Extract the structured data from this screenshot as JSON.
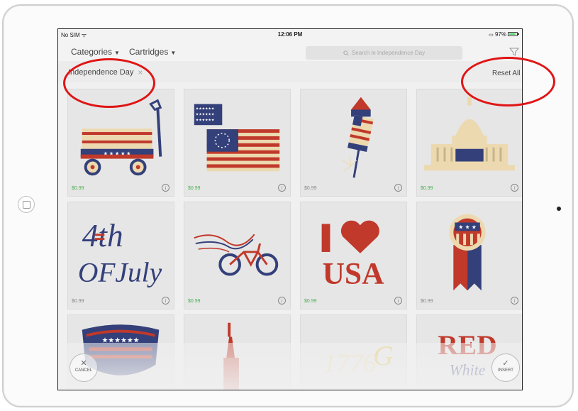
{
  "status_bar": {
    "carrier": "No SIM ᯤ",
    "time": "12:06 PM",
    "battery": "97%"
  },
  "toolbar": {
    "categories_label": "Categories",
    "cartridges_label": "Cartridges",
    "search_placeholder": "Search in Independence Day"
  },
  "filters": {
    "active_chip": "Independence Day",
    "chip_close": "×",
    "reset_label": "Reset All"
  },
  "tiles": [
    {
      "name": "wagon",
      "price": "$0.99"
    },
    {
      "name": "flags",
      "price": "$0.99"
    },
    {
      "name": "firework-rocket",
      "price": "$0.99"
    },
    {
      "name": "capitol",
      "price": "$0.99"
    },
    {
      "name": "4th-of-july",
      "price": "$0.99"
    },
    {
      "name": "bicycle",
      "price": "$0.99"
    },
    {
      "name": "i-love-usa",
      "price": "$0.99"
    },
    {
      "name": "ribbon-badge",
      "price": "$0.99"
    },
    {
      "name": "shield",
      "price": ""
    },
    {
      "name": "statue-of-liberty",
      "price": ""
    },
    {
      "name": "1776",
      "price": ""
    },
    {
      "name": "red-white",
      "price": ""
    }
  ],
  "info_glyph": "i",
  "bottom": {
    "cancel_label": "CANCEL",
    "insert_label": "INSERT"
  },
  "colors": {
    "red": "#c0392b",
    "navy": "#34407a",
    "cream": "#ecd9b0",
    "green_price": "#4caf50",
    "annotation": "#e01515"
  }
}
